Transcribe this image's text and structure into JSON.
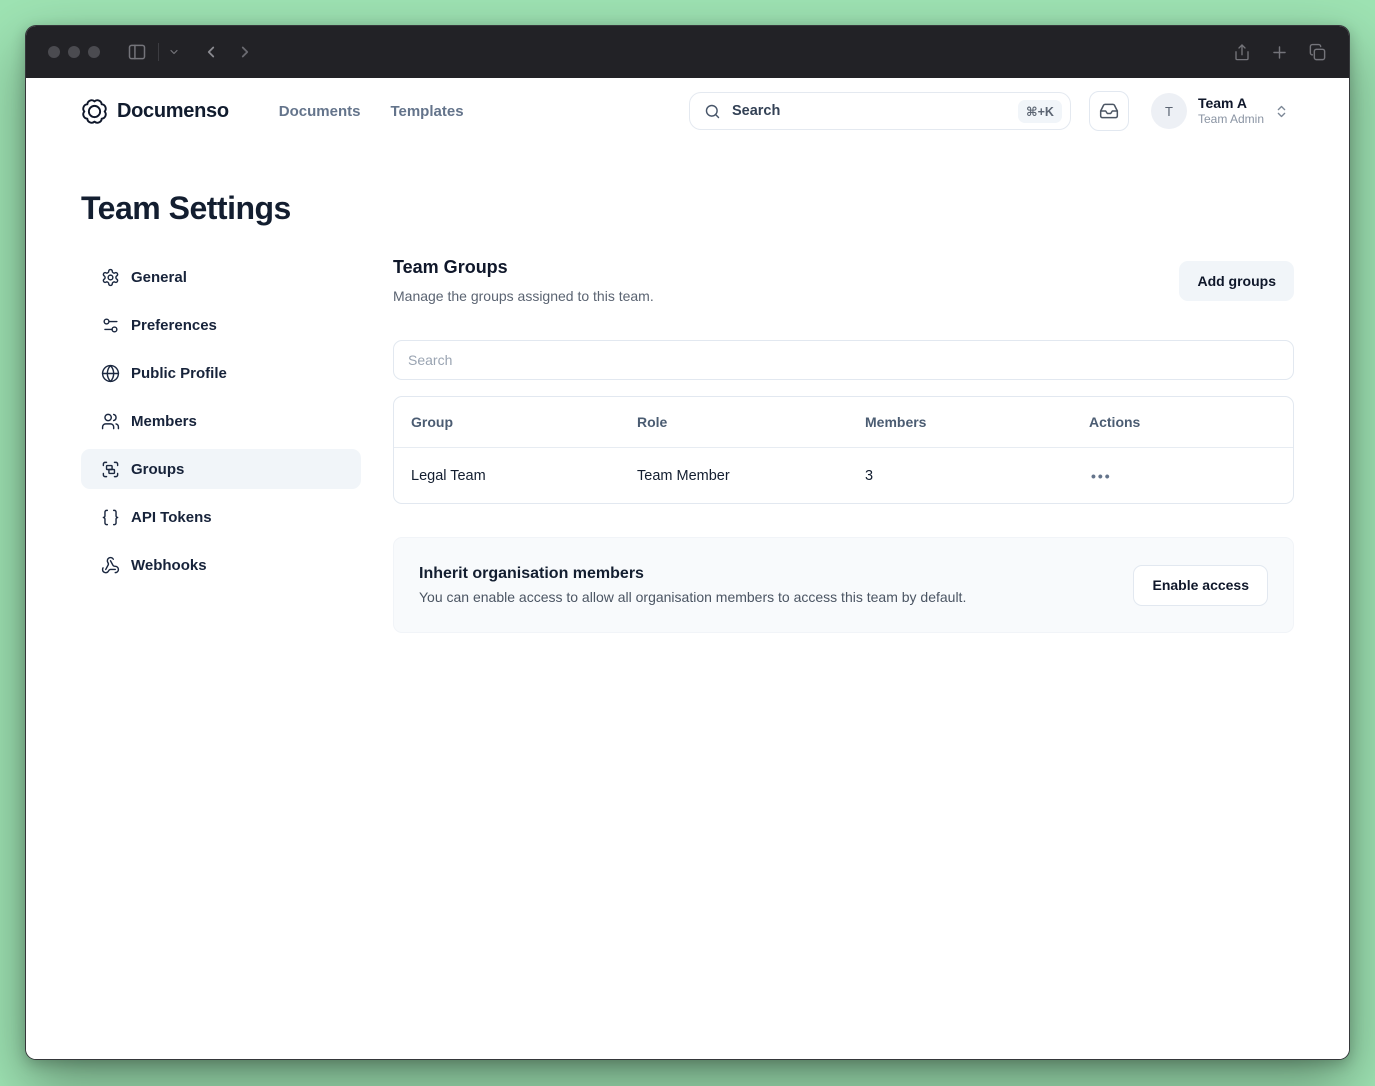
{
  "colors": {
    "desktop_background": "#9ee3b3",
    "titlebar": "#222226",
    "brand_text": "#0f172a",
    "muted_text": "#64748b",
    "active_item_bg": "#f1f5f9",
    "border": "#e2e8f0",
    "card_bg": "#f8fafc"
  },
  "header": {
    "brand": "Documenso",
    "nav": [
      {
        "label": "Documents"
      },
      {
        "label": "Templates"
      }
    ],
    "search": {
      "placeholder": "Search",
      "shortcut": "⌘+K"
    },
    "account": {
      "initial": "T",
      "team": "Team A",
      "role": "Team Admin"
    }
  },
  "page": {
    "title": "Team Settings",
    "sidebar": {
      "items": [
        {
          "label": "General",
          "icon": "gear-icon"
        },
        {
          "label": "Preferences",
          "icon": "sliders-icon"
        },
        {
          "label": "Public Profile",
          "icon": "globe-icon"
        },
        {
          "label": "Members",
          "icon": "users-icon"
        },
        {
          "label": "Groups",
          "icon": "group-icon",
          "active": true
        },
        {
          "label": "API Tokens",
          "icon": "braces-icon"
        },
        {
          "label": "Webhooks",
          "icon": "webhook-icon"
        }
      ]
    },
    "groups_section": {
      "title": "Team Groups",
      "subtitle": "Manage the groups assigned to this team.",
      "add_button": "Add groups",
      "search_placeholder": "Search",
      "table": {
        "headers": [
          "Group",
          "Role",
          "Members",
          "Actions"
        ],
        "rows": [
          {
            "group": "Legal Team",
            "role": "Team Member",
            "members": "3",
            "actions": "•••"
          }
        ]
      }
    },
    "inherit_section": {
      "title": "Inherit organisation members",
      "description": "You can enable access to allow all organisation members to access this team by default.",
      "button": "Enable access"
    }
  }
}
